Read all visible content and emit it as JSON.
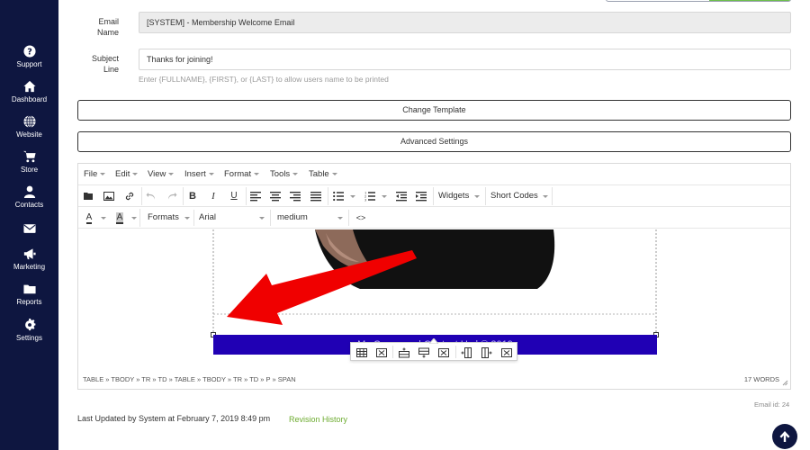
{
  "sidebar": {
    "items": [
      {
        "label": "Support",
        "icon": "question-circle-icon"
      },
      {
        "label": "Dashboard",
        "icon": "home-icon"
      },
      {
        "label": "Website",
        "icon": "globe-icon"
      },
      {
        "label": "Store",
        "icon": "cart-icon"
      },
      {
        "label": "Contacts",
        "icon": "user-icon"
      },
      {
        "label": "",
        "icon": "envelope-icon"
      },
      {
        "label": "Marketing",
        "icon": "megaphone-icon"
      },
      {
        "label": "Reports",
        "icon": "folder-icon"
      },
      {
        "label": "Settings",
        "icon": "gear-icon"
      }
    ]
  },
  "form": {
    "email_name_label": "Email Name",
    "email_name_value": "[SYSTEM] - Membership Welcome Email",
    "subject_label": "Subject Line",
    "subject_value": "Thanks for joining!",
    "hint": "Enter {FULLNAME}, {FIRST}, or {LAST} to allow users name to be printed",
    "change_template": "Change Template",
    "advanced_settings": "Advanced Settings"
  },
  "editor": {
    "menu": [
      "File",
      "Edit",
      "View",
      "Insert",
      "Format",
      "Tools",
      "Table"
    ],
    "widgets": "Widgets",
    "short_codes": "Short Codes",
    "formats": "Formats",
    "font": "Arial",
    "size": "medium",
    "footer_text": "My Company | Contact Us | © 2019",
    "path": "TABLE » TBODY » TR » TD » TABLE » TBODY » TR » TD » P » SPAN",
    "word_count": "17 WORDS"
  },
  "email_id": "Email id: 24",
  "last_updated": "Last Updated by System at February 7, 2019 8:49 pm",
  "revision_history": "Revision History",
  "colors": {
    "sidebar": "#0e1640",
    "footer_bar": "#2000b4",
    "annotation_arrow": "#f00000",
    "link_green": "#6cab2f"
  }
}
